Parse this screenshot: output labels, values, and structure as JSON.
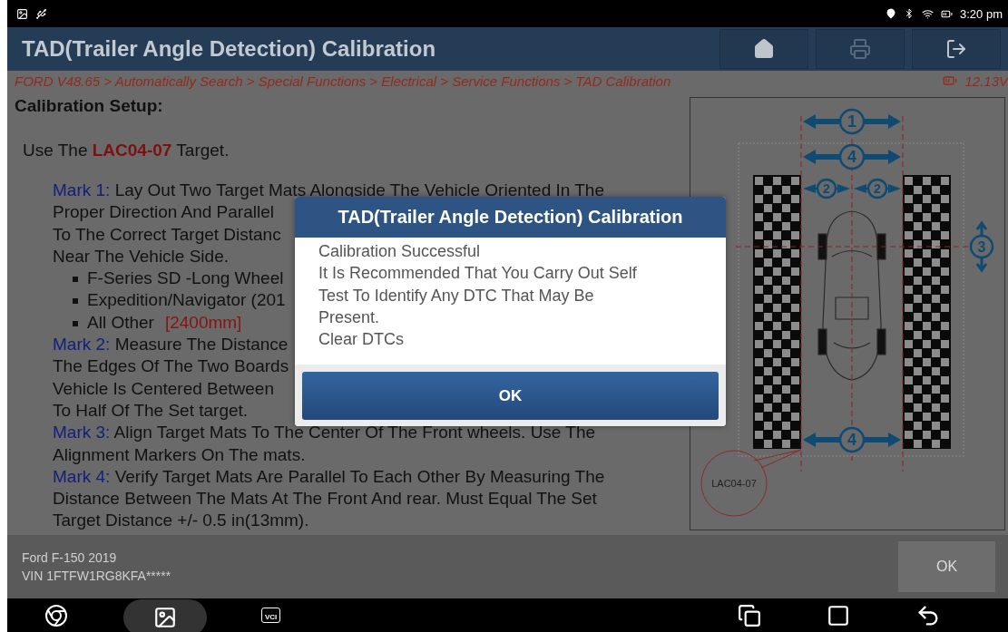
{
  "status_bar": {
    "time": "3:20 pm"
  },
  "header": {
    "title": "TAD(Trailer Angle Detection) Calibration"
  },
  "breadcrumb": {
    "path": "FORD V48.65 > Automatically Search > Special Functions > Electrical > Service Functions > TAD Calibration",
    "voltage": "12.13V"
  },
  "content": {
    "heading": "Calibration Setup:",
    "intro": "Use The **LAC04-07** Target.",
    "lines": [
      {
        "kind": "mark",
        "label": "Mark 1:",
        "text": " Lay Out Two Target Mats Alongside The Vehicle Oriented In The"
      },
      {
        "kind": "text",
        "text": "Proper Direction And Parallel"
      },
      {
        "kind": "text",
        "text": "To The Correct Target Distanc"
      },
      {
        "kind": "text",
        "text": "Near The Vehicle Side."
      },
      {
        "kind": "bullet",
        "text": "F-Series SD -Long Wheel"
      },
      {
        "kind": "bullet",
        "text": "Expedition/Navigator (201"
      },
      {
        "kind": "bullet",
        "text": "All Other",
        "note": "[2400mm]"
      },
      {
        "kind": "mark",
        "label": "Mark 2:",
        "text": " Measure The Distance"
      },
      {
        "kind": "text",
        "text": "The Edges Of The Two Boards"
      },
      {
        "kind": "text",
        "text": "Vehicle Is Centered Between"
      },
      {
        "kind": "text",
        "text": "To Half Of The Set target."
      },
      {
        "kind": "mark",
        "label": "Mark 3:",
        "text": " Align Target Mats To The Center Of The Front wheels. Use The"
      },
      {
        "kind": "text",
        "text": "Alignment Markers On The mats."
      },
      {
        "kind": "mark",
        "label": "Mark 4:",
        "text": " Verify Target Mats Are Parallel To Each Other By Measuring The"
      },
      {
        "kind": "text",
        "text": "Distance Between The Mats At The Front And rear. Must Equal The Set"
      },
      {
        "kind": "text",
        "text": "Target Distance +/- 0.5 in(13mm)."
      }
    ]
  },
  "diagram": {
    "labels": [
      {
        "kind": "top-width",
        "text": "1"
      },
      {
        "kind": "top-distance",
        "text": "4"
      },
      {
        "kind": "half-left",
        "text": "2"
      },
      {
        "kind": "half-right",
        "text": "2"
      },
      {
        "kind": "axle",
        "text": "3"
      },
      {
        "kind": "bottom-distance",
        "text": "4"
      }
    ],
    "target_label": "LAC04-07"
  },
  "dialog": {
    "title": "TAD(Trailer Angle Detection) Calibration",
    "lines": [
      "Calibration Successful",
      "It Is Recommended That You Carry Out  Self",
      "Test To Identify Any DTC That May Be",
      "Present.",
      "Clear DTCs"
    ],
    "button": "OK"
  },
  "footer": {
    "vehicle": "Ford F-150 2019",
    "vin": "VIN 1FTFW1RG8KFA*****",
    "button": "OK"
  },
  "nav_bar": {
    "vci_label": "VCI"
  }
}
